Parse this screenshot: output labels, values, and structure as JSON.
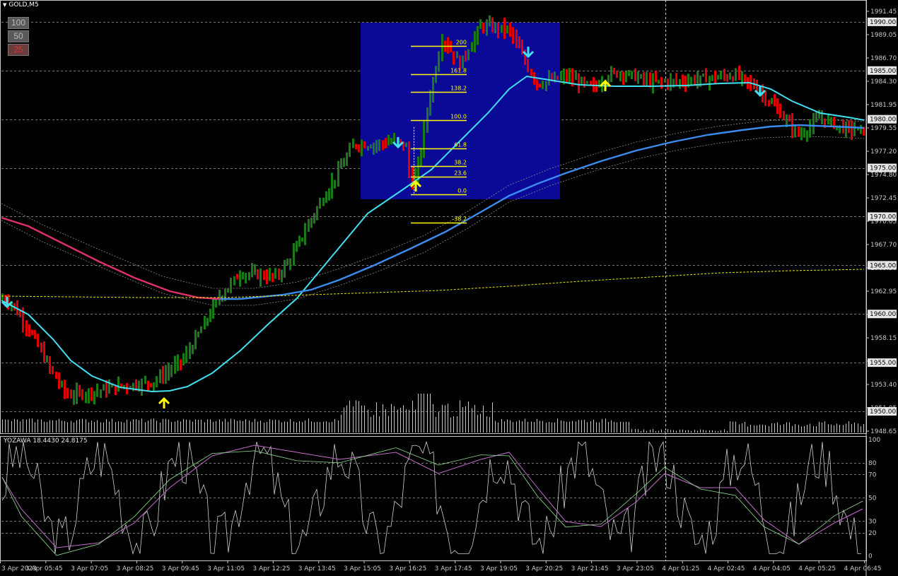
{
  "header": {
    "symbol": "GOLD,M5"
  },
  "scale_buttons": [
    "100",
    "50",
    "25"
  ],
  "oscillator": {
    "label": "YOZAWA 18.4430 24.8175",
    "levels": [
      100,
      80,
      70,
      50,
      30,
      20,
      0
    ]
  },
  "price_axis": {
    "ticks": [
      "1991.45",
      "1989.05",
      "1986.70",
      "1984.30",
      "1981.95",
      "1979.55",
      "1977.20",
      "1974.80",
      "1972.45",
      "1970.05",
      "1967.70",
      "1965.30",
      "1962.95",
      "1960.55",
      "1958.15",
      "1955.80",
      "1953.40",
      "1951.05",
      "1948.65"
    ],
    "highlighted_levels": [
      "1990.00",
      "1985.00",
      "1980.00",
      "1975.00",
      "1970.00",
      "1965.00",
      "1960.00",
      "1955.00",
      "1950.00"
    ]
  },
  "time_axis": [
    "3 Apr 2023",
    "3 Apr 05:45",
    "3 Apr 07:05",
    "3 Apr 08:25",
    "3 Apr 09:45",
    "3 Apr 11:05",
    "3 Apr 12:25",
    "3 Apr 13:45",
    "3 Apr 15:05",
    "3 Apr 16:25",
    "3 Apr 17:45",
    "3 Apr 19:05",
    "3 Apr 20:25",
    "3 Apr 21:45",
    "3 Apr 23:05",
    "4 Apr 01:25",
    "4 Apr 02:45",
    "4 Apr 04:05",
    "4 Apr 05:25",
    "4 Apr 06:45"
  ],
  "fibonacci": {
    "levels": [
      "200",
      "161.8",
      "138.2",
      "100.0",
      "61.8",
      "38.2",
      "23.6",
      "0.0",
      "-38.2"
    ],
    "color": "#ffff00",
    "box_color": "#0a0a96"
  },
  "colors": {
    "bull": "#1a7a1a",
    "bear": "#e00000",
    "fast_ma": "#40e0f0",
    "slow_ma": "#3c8cf0",
    "old_ma": "#e0306a",
    "long_ma": "#e6e600",
    "arrow_up": "#ffff00",
    "arrow_down": "#40e0f0"
  }
}
